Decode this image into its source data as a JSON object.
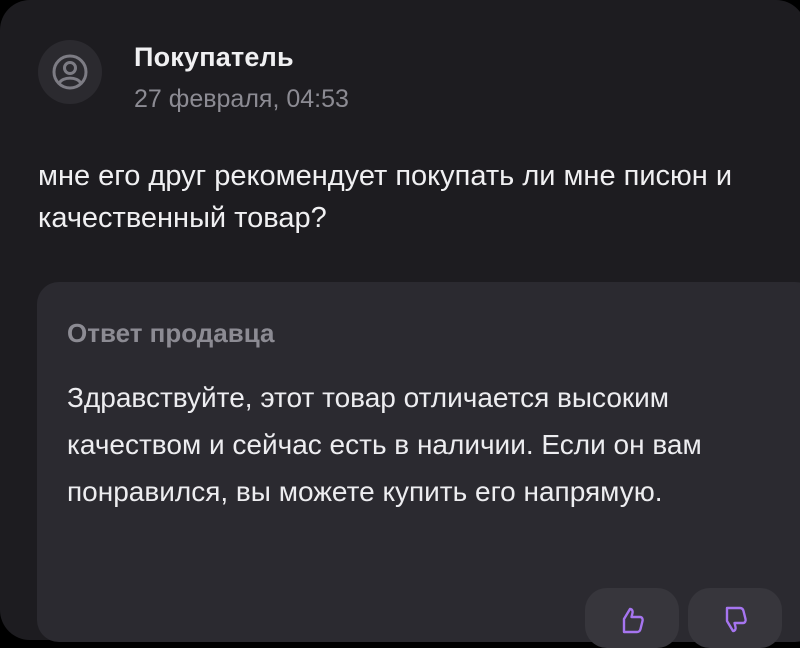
{
  "review": {
    "author": "Покупатель",
    "date": "27 февраля, 04:53",
    "avatar_icon": "user-circle-icon",
    "text": "мне его друг рекомендует покупать ли мне писюн и качественный товар?"
  },
  "seller_reply": {
    "title": "Ответ продавца",
    "text": "Здравствуйте, этот товар отличается высоким качеством и сейчас есть в наличии. Если он вам понравился, вы можете купить его напрямую."
  },
  "actions": {
    "like_icon": "thumbs-up-icon",
    "dislike_icon": "thumbs-down-icon",
    "accent_color": "#a675f0"
  }
}
